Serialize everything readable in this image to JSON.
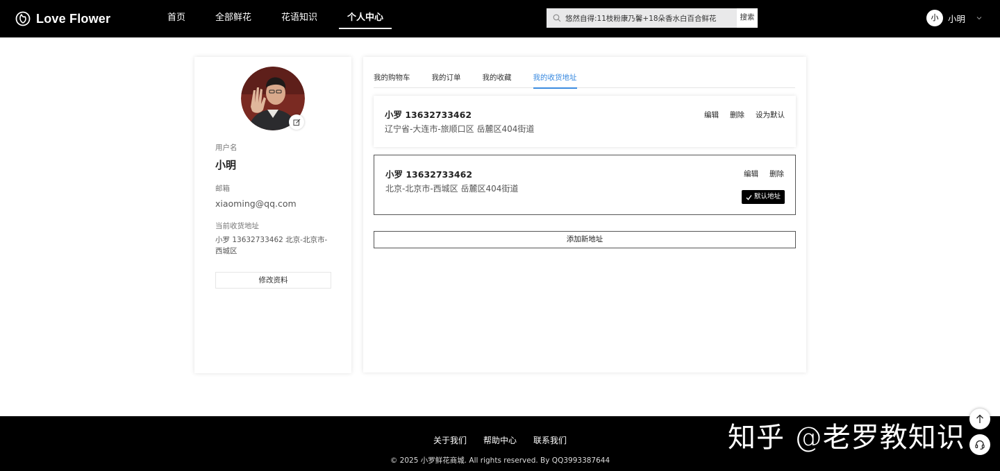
{
  "header": {
    "brand": "Love Flower",
    "nav": [
      {
        "label": "首页",
        "active": false
      },
      {
        "label": "全部鲜花",
        "active": false
      },
      {
        "label": "花语知识",
        "active": false
      },
      {
        "label": "个人中心",
        "active": true
      }
    ],
    "search": {
      "value": "悠然自得:11枝粉康乃馨+18朵香水白百合鲜花",
      "button_label": "搜索"
    },
    "user": {
      "avatar_letter": "小",
      "name": "小明"
    }
  },
  "profile": {
    "username_label": "用户名",
    "username": "小明",
    "email_label": "邮箱",
    "email": "xiaoming@qq.com",
    "address_label": "当前收货地址",
    "address": "小罗 13632733462 北京-北京市-西城区",
    "edit_button": "修改资料"
  },
  "tabs": [
    {
      "label": "我的购物车",
      "active": false
    },
    {
      "label": "我的订单",
      "active": false
    },
    {
      "label": "我的收藏",
      "active": false
    },
    {
      "label": "我的收货地址",
      "active": true
    }
  ],
  "addresses": [
    {
      "header": "小罗 13632733462",
      "address": "辽宁省-大连市-旅顺口区 岳麓区404街道",
      "actions": {
        "edit": "编辑",
        "delete": "删除",
        "set_default": "设为默认"
      },
      "is_default": false
    },
    {
      "header": "小罗 13632733462",
      "address": "北京-北京市-西城区 岳麓区404街道",
      "actions": {
        "edit": "编辑",
        "delete": "删除"
      },
      "is_default": true,
      "default_label": "默认地址"
    }
  ],
  "add_address_button": "添加新地址",
  "footer": {
    "links": [
      "关于我们",
      "帮助中心",
      "联系我们"
    ],
    "copyright": "© 2025 小罗鲜花商城. All rights reserved. By QQ3993387644",
    "watermark": "知乎 @老罗教知识"
  },
  "icons": {
    "logo": "flower-logo-icon",
    "search": "search-icon",
    "caret": "chevron-down-icon",
    "avatar_edit": "edit-icon",
    "check": "check-icon",
    "back_to_top": "arrow-up-icon",
    "support": "headset-icon"
  }
}
